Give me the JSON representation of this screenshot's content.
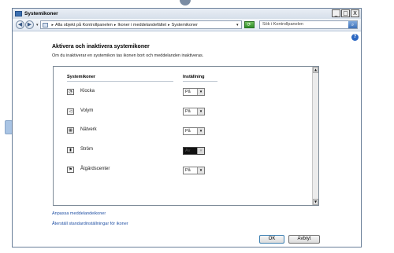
{
  "window": {
    "title": "Systemikoner",
    "caption_buttons": [
      "_",
      "□",
      "X"
    ]
  },
  "address": {
    "back_glyph": "◀",
    "forward_glyph": "▶",
    "breadcrumbs": [
      "Alla objekt på Kontrollpanelen",
      "Ikoner i meddelandefältet",
      "Systemikoner"
    ],
    "separator": "▸",
    "search_placeholder": "Sök i Kontrollpanelen"
  },
  "help_glyph": "?",
  "main": {
    "heading": "Aktivera och inaktivera systemikoner",
    "description": "Om du inaktiverar en systemikon tas ikonen bort och meddelanden inaktiveras.",
    "columns": {
      "icons": "Systemikoner",
      "setting": "Inställning"
    },
    "rows": [
      {
        "label": "Klocka",
        "value": "På",
        "icon": "clock-icon",
        "glyph": "◔",
        "disabled": false
      },
      {
        "label": "Volym",
        "value": "På",
        "icon": "speaker-icon",
        "glyph": "◁",
        "disabled": false
      },
      {
        "label": "Nätverk",
        "value": "På",
        "icon": "network-icon",
        "glyph": "▦",
        "disabled": false
      },
      {
        "label": "Ström",
        "value": "Av",
        "icon": "battery-icon",
        "glyph": "▮",
        "disabled": true
      },
      {
        "label": "Åtgärdscenter",
        "value": "På",
        "icon": "flag-icon",
        "glyph": "⚑",
        "disabled": false
      }
    ],
    "links": [
      "Anpassa meddelandeikoner",
      "Återställ standardinställningar för ikoner"
    ]
  },
  "footer": {
    "ok": "OK",
    "cancel": "Avbryt"
  },
  "colors": {
    "link": "#1f4fa3",
    "accent": "#2b67c2"
  }
}
